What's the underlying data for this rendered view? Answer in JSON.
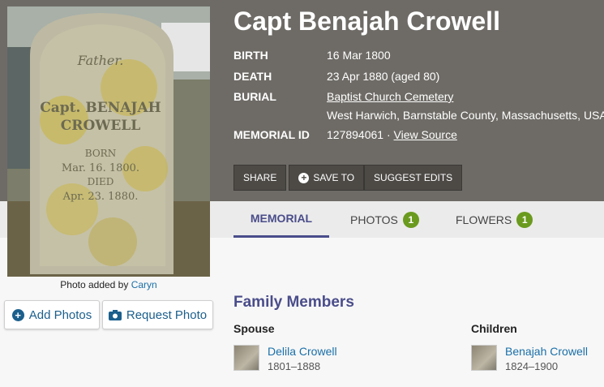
{
  "memorial": {
    "name": "Capt Benajah Crowell",
    "facts": [
      {
        "label": "BIRTH",
        "value": "16 Mar 1800"
      },
      {
        "label": "DEATH",
        "value": "23 Apr 1880 (aged 80)"
      },
      {
        "label": "BURIAL",
        "link": "Baptist Church Cemetery",
        "value": "West Harwich, Barnstable County, Massachusetts, USA"
      },
      {
        "label": "MEMORIAL ID",
        "value": "127894061 · ",
        "link": "View Source"
      }
    ]
  },
  "photo": {
    "caption_prefix": "Photo added by",
    "caption_user": "Caryn",
    "headstone_text": [
      "Father.",
      "Capt. BENAJAH",
      "CROWELL",
      "BORN",
      "Mar. 16. 1800.",
      "DIED",
      "Apr. 23. 1880."
    ]
  },
  "actions": {
    "share": "SHARE",
    "save": "SAVE TO",
    "suggest": "SUGGEST EDITS"
  },
  "side_buttons": {
    "add_photos": "Add Photos",
    "request_photo": "Request Photo"
  },
  "tabs": [
    {
      "label": "MEMORIAL"
    },
    {
      "label": "PHOTOS",
      "count": "1"
    },
    {
      "label": "FLOWERS",
      "count": "1"
    }
  ],
  "family": {
    "title": "Family Members",
    "spouse_label": "Spouse",
    "children_label": "Children",
    "spouse": {
      "name": "Delila Crowell",
      "years": "1801–1888"
    },
    "child": {
      "name": "Benajah Crowell",
      "years": "1824–1900"
    }
  },
  "colors": {
    "header": "#6e6b66",
    "accent": "#4a4d8a",
    "link": "#1a6fa8",
    "badge": "#6a9a1e"
  }
}
